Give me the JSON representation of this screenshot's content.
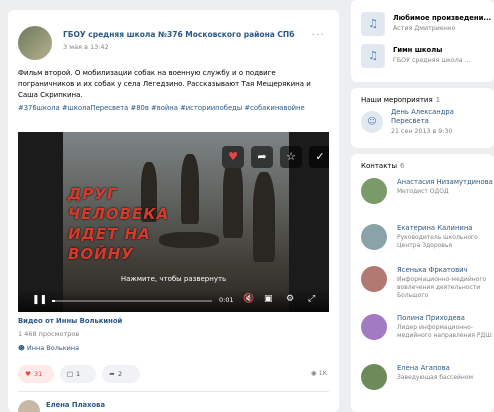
{
  "post": {
    "group_name": "ГБОУ средняя школа №376 Московского района СПб",
    "date": "3 мая в 13:42",
    "more_icon": "more-dots-icon",
    "text": "Фильм второй. О мобилизации собак на военную службу и о подвиге пограничников и их собак у села Легедзино. Рассказывают Тая Мещерякина и Саша Скрипкина.",
    "hashtags": "#376школа #школаПересвета #80в #война #историипобеды #собакинавойне",
    "video": {
      "title": "ДРУГ\nЧЕЛОВЕКА\nИДЕТ НА\nВОЙНУ",
      "hint": "Нажмите, чтобы развернуть",
      "time": "0:01",
      "progress": 0.02,
      "author": "Видео от Инны Волькиной",
      "views": "1 468 просмотров",
      "uploader": "Инна Волькина"
    },
    "actions": {
      "likes": "31",
      "comments": "1",
      "shares": "2",
      "views": "1K"
    },
    "comment": {
      "author": "Елена Плахова",
      "emoji": "👏👏👏"
    }
  },
  "sidebar": {
    "audio": [
      {
        "title": "Любимое произведени...",
        "artist": "Астия Дмитриенко",
        "icon": "music-note-icon"
      },
      {
        "title": "Гимн школы",
        "artist": "ГБОУ средняя школа ...",
        "icon": "music-note-icon"
      }
    ],
    "events": {
      "title": "Наши мероприятия",
      "count": "1",
      "name": "День Александра Пересвета",
      "date": "21 сен 2013 в 9:30"
    },
    "contacts": {
      "title": "Контакты",
      "count": "6",
      "items": [
        {
          "name": "Анастасия Низамутдинова",
          "role": "Методист ОДОД",
          "color": "#7a9a6a"
        },
        {
          "name": "Екатерина Калинина",
          "role": "Руководитель школьного Центра Здоровья",
          "color": "#8aa3a8"
        },
        {
          "name": "Ясенька Фркатович",
          "role": "Информационно-медийного вовлечения деятельности Большого",
          "color": "#b07a72"
        },
        {
          "name": "Полина Приходева",
          "role": "Лидер информационно-медийного направления РДШ",
          "color": "#a27ac4"
        },
        {
          "name": "Елена Агапова",
          "role": "Заведующая бассейном",
          "color": "#6d8a5a"
        }
      ]
    }
  }
}
